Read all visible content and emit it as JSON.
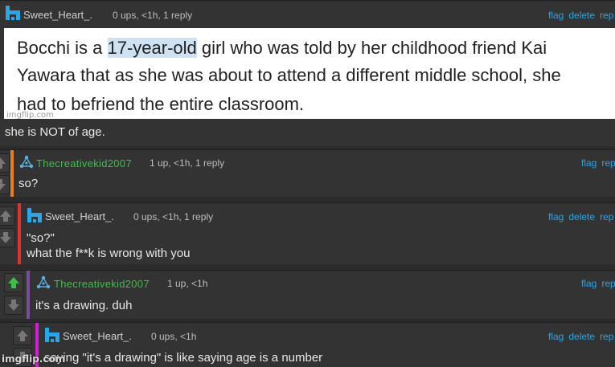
{
  "comments": [
    {
      "user": "Sweet_Heart_.",
      "meta": "0 ups, <1h, 1 reply",
      "links": [
        "flag",
        "delete",
        "rep"
      ],
      "image_lines": [
        {
          "pre": "Bocchi is a ",
          "highlight": "17-year-old",
          "post": " girl who was told by her childhood friend Kai"
        },
        {
          "pre": "Yawara that as she was about to attend a different middle school, she",
          "highlight": "",
          "post": ""
        },
        {
          "pre": "had to befriend the entire classroom.",
          "highlight": "",
          "post": ""
        }
      ],
      "image_watermark": "imgflip.com",
      "text": "she is NOT of age."
    },
    {
      "user": "Thecreativekid2007",
      "meta": "1 up, <1h, 1 reply",
      "links": [
        "flag",
        "rep"
      ],
      "text": "so?",
      "bar_color": "#e87d1e"
    },
    {
      "user": "Sweet_Heart_.",
      "meta": "0 ups, <1h, 1 reply",
      "links": [
        "flag",
        "delete",
        "rep"
      ],
      "text_lines": [
        "\"so?\"",
        "what the f**k is wrong with you"
      ],
      "bar_color": "#e03030"
    },
    {
      "user": "Thecreativekid2007",
      "meta": "1 up, <1h",
      "links": [
        "flag",
        "rep"
      ],
      "text": "it's a drawing. duh",
      "bar_color": "#7a4f9a"
    },
    {
      "user": "Sweet_Heart_.",
      "meta": "0 ups, <1h",
      "links": [
        "flag",
        "delete",
        "rep"
      ],
      "text": "saying \"it's a drawing\" is like saying age is a number",
      "bar_color": "#d21fd2"
    }
  ],
  "colors": {
    "link": "#2aa6e6",
    "green_user": "#3fbf4a",
    "upvote_active": "#3fbf4a"
  },
  "icons": {
    "sweet_avatar": "pixel-avatar-icon",
    "creative_avatar": "triangle-avatar-icon",
    "upvote": "arrow-up-icon",
    "downvote": "arrow-down-icon"
  },
  "footer_watermark": "imgflip.com"
}
